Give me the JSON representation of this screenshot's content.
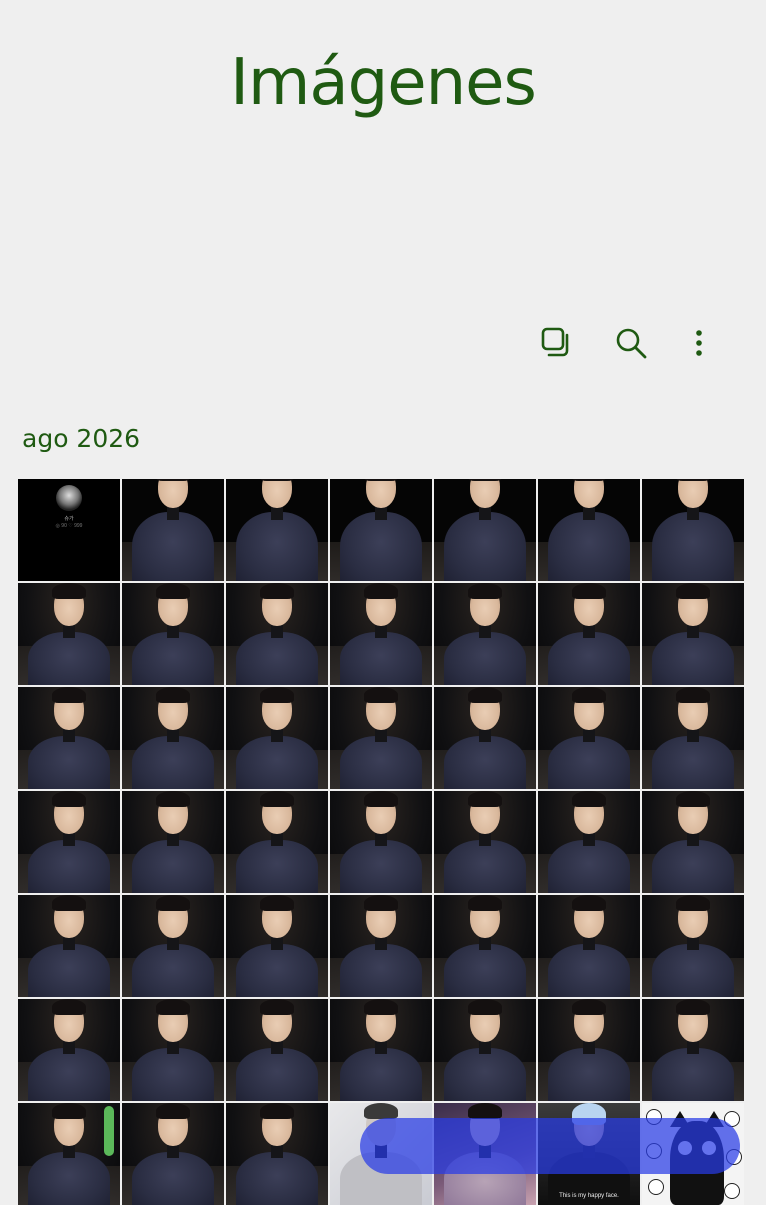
{
  "header": {
    "title": "Imágenes"
  },
  "toolbar": {
    "icons": [
      "select-icon",
      "search-icon",
      "more-options-icon"
    ]
  },
  "section": {
    "label": "ago 2026"
  },
  "thumb_overlays": {
    "first_thumb_name": "슈가",
    "first_thumb_stats": "◎ 90  ♡ 999",
    "caption_text": "This is my happy face."
  },
  "colors": {
    "accent": "#1f5a12",
    "background": "#efefef",
    "scroll_thumb": "#5bb85a",
    "overlay_band": "#283ce6"
  }
}
